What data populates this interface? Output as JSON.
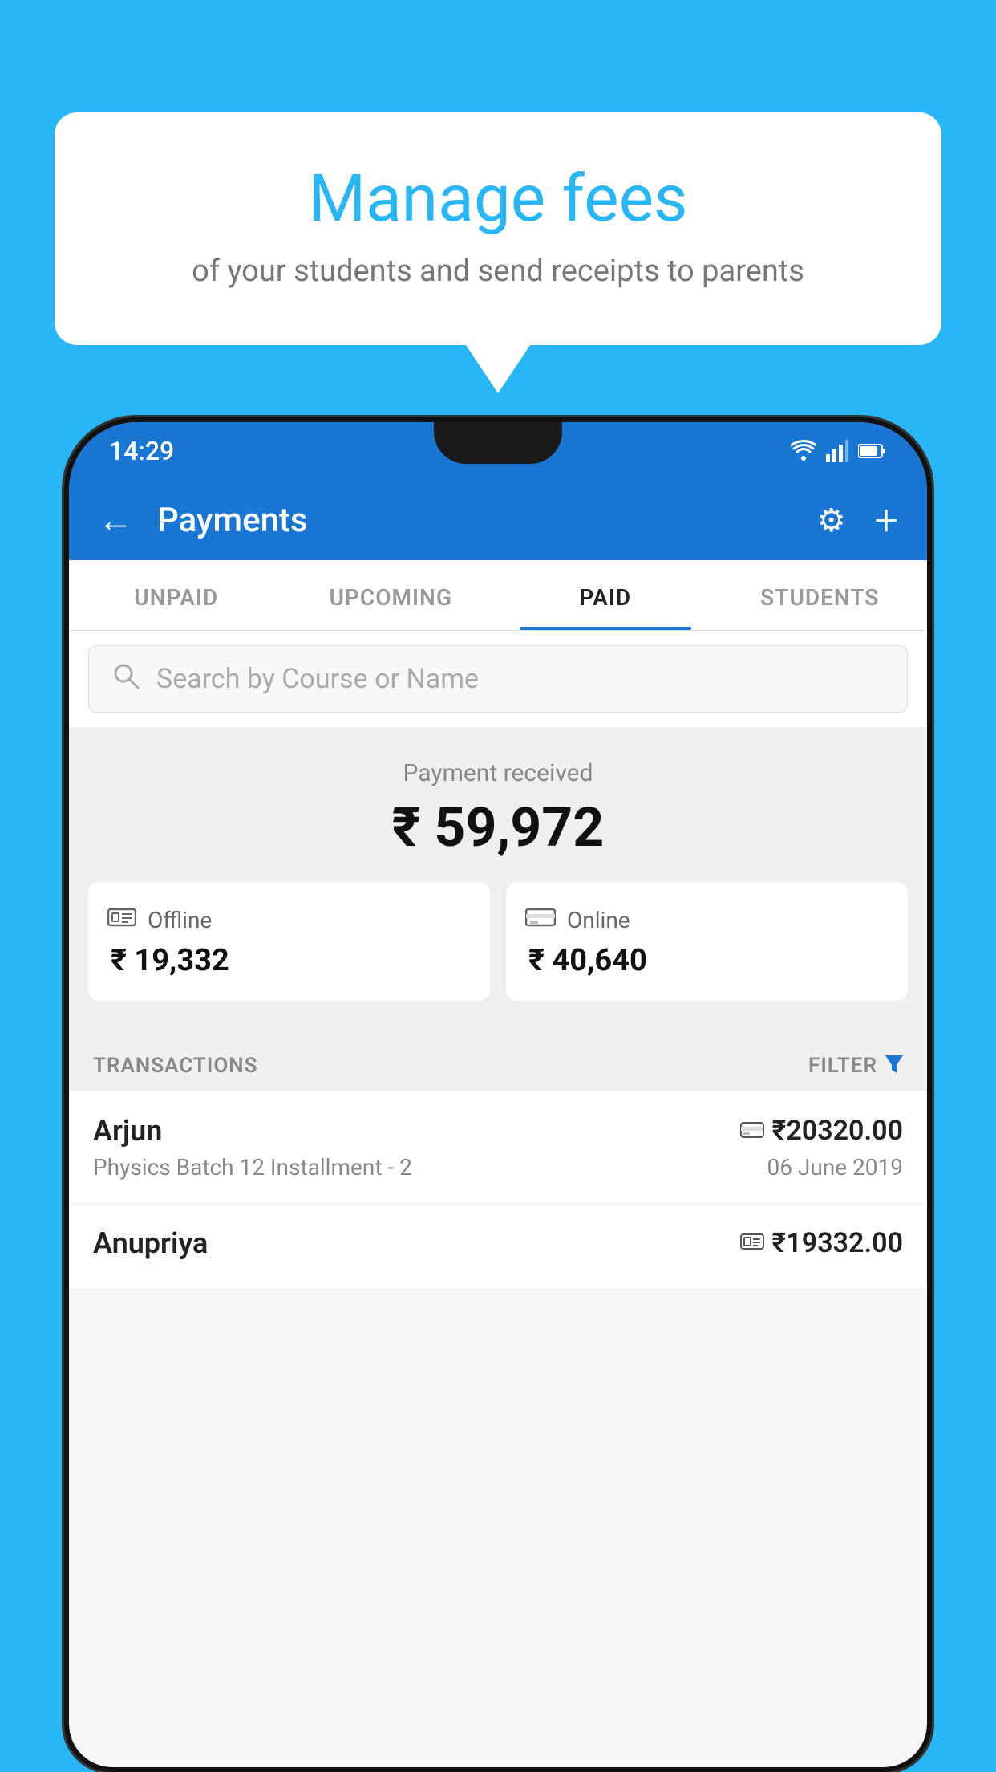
{
  "background_color": "#29b6f6",
  "speech_bubble": {
    "title": "Manage fees",
    "subtitle": "of your students and send receipts to parents"
  },
  "status_bar": {
    "time": "14:29",
    "icons": [
      "wifi",
      "signal",
      "battery"
    ]
  },
  "app_bar": {
    "title": "Payments",
    "back_icon": "←",
    "settings_icon": "⚙",
    "add_icon": "+"
  },
  "tabs": [
    {
      "label": "UNPAID",
      "active": false
    },
    {
      "label": "UPCOMING",
      "active": false
    },
    {
      "label": "PAID",
      "active": true
    },
    {
      "label": "STUDENTS",
      "active": false
    }
  ],
  "search": {
    "placeholder": "Search by Course or Name"
  },
  "payment_summary": {
    "received_label": "Payment received",
    "received_amount": "₹ 59,972",
    "offline": {
      "label": "Offline",
      "amount": "₹ 19,332"
    },
    "online": {
      "label": "Online",
      "amount": "₹ 40,640"
    }
  },
  "transactions_section": {
    "label": "TRANSACTIONS",
    "filter_label": "FILTER"
  },
  "transactions": [
    {
      "name": "Arjun",
      "amount": "₹20320.00",
      "course": "Physics Batch 12 Installment - 2",
      "date": "06 June 2019",
      "payment_type": "card"
    },
    {
      "name": "Anupriya",
      "amount": "₹19332.00",
      "course": "",
      "date": "",
      "payment_type": "cash"
    }
  ]
}
